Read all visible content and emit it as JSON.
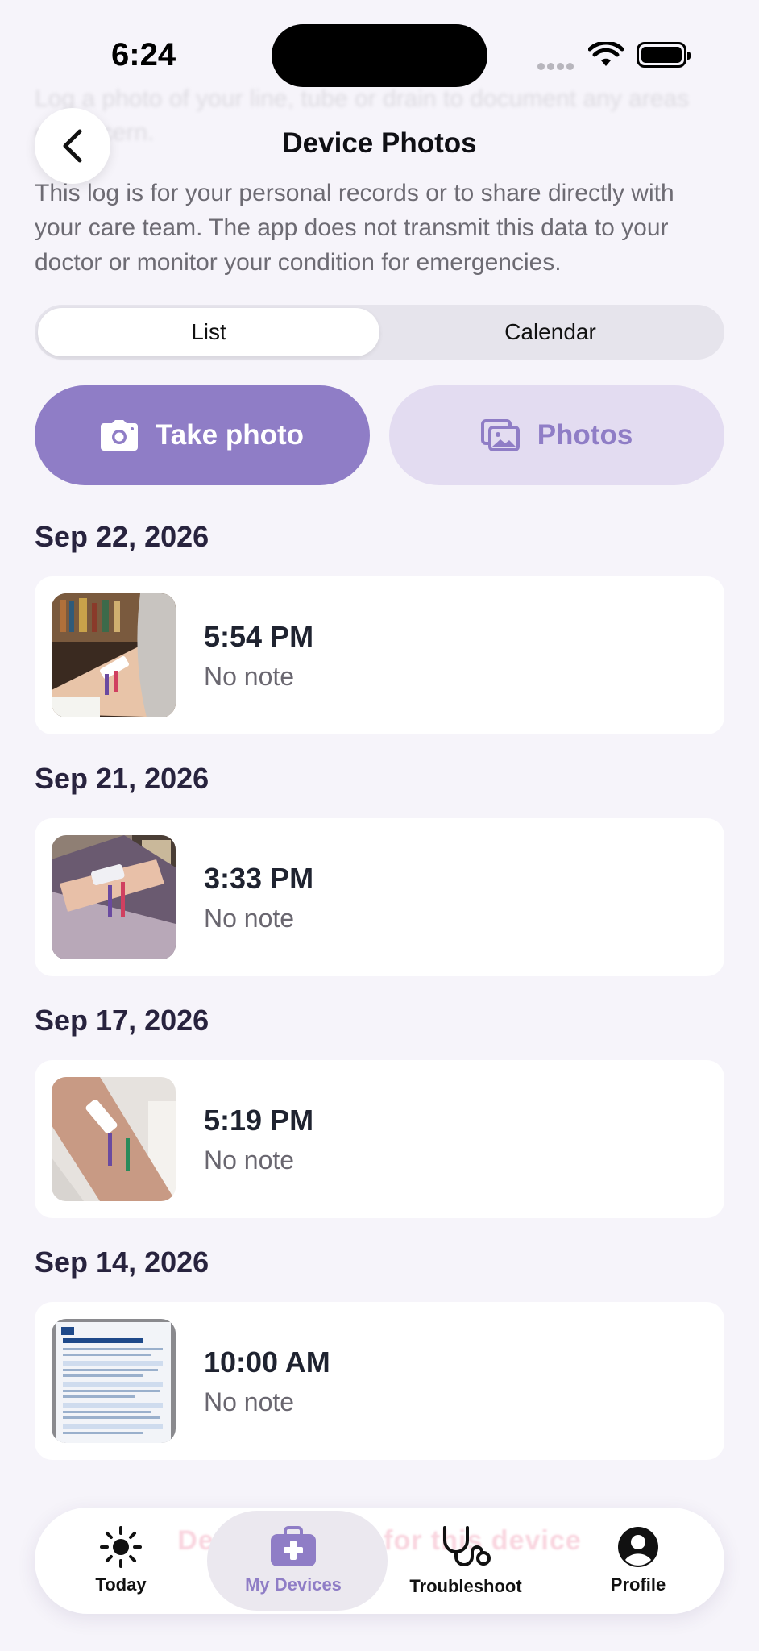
{
  "status_bar": {
    "time": "6:24"
  },
  "faded_intro": "Log a photo of your line, tube or drain to document any areas of concern.",
  "header": {
    "title": "Device Photos",
    "back_label": "Back"
  },
  "disclaimer": "This log is for your personal records or to share directly with your care team. The app does not transmit this data to your doctor or monitor your condition for emergencies.",
  "segmented": {
    "list": "List",
    "calendar": "Calendar",
    "selected": "List"
  },
  "actions": {
    "take_photo": "Take photo",
    "photos": "Photos"
  },
  "entries": [
    {
      "date": "Sep 22, 2026",
      "time": "5:54 PM",
      "note": "No note",
      "thumb": "photo of arm with PICC line at desk"
    },
    {
      "date": "Sep 21, 2026",
      "time": "3:33 PM",
      "note": "No note",
      "thumb": "photo of arm with PICC line dressing"
    },
    {
      "date": "Sep 17, 2026",
      "time": "5:19 PM",
      "note": "No note",
      "thumb": "photo of arm with PICC line lumens"
    },
    {
      "date": "Sep 14, 2026",
      "time": "10:00 AM",
      "note": "No note",
      "thumb": "photo of PICC Line Home Care Instructions sheet"
    }
  ],
  "tabbar": {
    "overlay_text": "Device photos for this device",
    "tabs": [
      {
        "label": "Today",
        "icon": "sun-icon"
      },
      {
        "label": "My Devices",
        "icon": "medical-bag-icon",
        "active": true
      },
      {
        "label": "Troubleshoot",
        "icon": "stethoscope-icon"
      },
      {
        "label": "Profile",
        "icon": "person-icon"
      }
    ]
  },
  "colors": {
    "accent": "#8f7dc6",
    "accent_light": "#e3dcf1",
    "background": "#f6f4fa"
  }
}
